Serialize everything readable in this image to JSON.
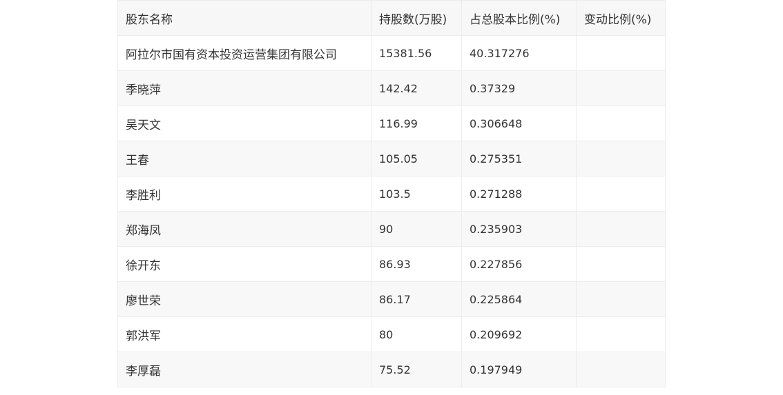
{
  "table": {
    "headers": [
      "股东名称",
      "持股数(万股)",
      "占总股本比例(%)",
      "变动比例(%)"
    ],
    "rows": [
      {
        "name": "阿拉尔市国有资本投资运营集团有限公司",
        "shares": "15381.56",
        "ratio": "40.317276",
        "change": ""
      },
      {
        "name": "季晓萍",
        "shares": "142.42",
        "ratio": "0.37329",
        "change": ""
      },
      {
        "name": "吴天文",
        "shares": "116.99",
        "ratio": "0.306648",
        "change": ""
      },
      {
        "name": "王春",
        "shares": "105.05",
        "ratio": "0.275351",
        "change": ""
      },
      {
        "name": "李胜利",
        "shares": "103.5",
        "ratio": "0.271288",
        "change": ""
      },
      {
        "name": "郑海凤",
        "shares": "90",
        "ratio": "0.235903",
        "change": ""
      },
      {
        "name": "徐开东",
        "shares": "86.93",
        "ratio": "0.227856",
        "change": ""
      },
      {
        "name": "廖世荣",
        "shares": "86.17",
        "ratio": "0.225864",
        "change": ""
      },
      {
        "name": "郭洪军",
        "shares": "80",
        "ratio": "0.209692",
        "change": ""
      },
      {
        "name": "李厚磊",
        "shares": "75.52",
        "ratio": "0.197949",
        "change": ""
      }
    ]
  }
}
